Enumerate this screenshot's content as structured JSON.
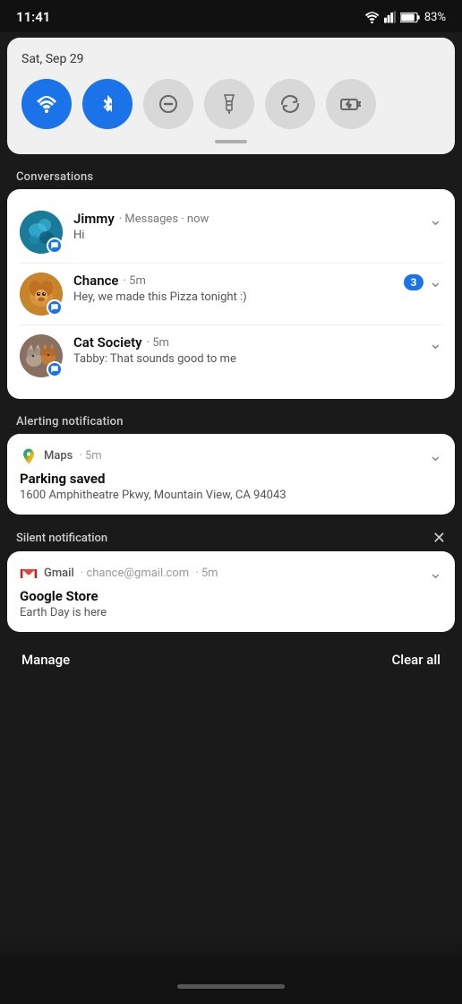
{
  "statusBar": {
    "time": "11:41",
    "battery": "83%"
  },
  "quickSettings": {
    "date": "Sat, Sep 29",
    "buttons": [
      {
        "id": "wifi",
        "label": "WiFi",
        "active": true
      },
      {
        "id": "bluetooth",
        "label": "Bluetooth",
        "active": true
      },
      {
        "id": "dnd",
        "label": "Do Not Disturb",
        "active": false
      },
      {
        "id": "flashlight",
        "label": "Flashlight",
        "active": false
      },
      {
        "id": "rotate",
        "label": "Auto Rotate",
        "active": false
      },
      {
        "id": "battery",
        "label": "Battery Saver",
        "active": false
      }
    ]
  },
  "sections": {
    "conversations": "Conversations",
    "alerting": "Alerting notification",
    "silent": "Silent notification"
  },
  "conversations": [
    {
      "name": "Jimmy",
      "app": "Messages",
      "time": "now",
      "message": "Hi",
      "badge": null
    },
    {
      "name": "Chance",
      "app": "",
      "time": "5m",
      "message": "Hey, we made this Pizza tonight :)",
      "badge": "3"
    },
    {
      "name": "Cat Society",
      "app": "",
      "time": "5m",
      "message": "Tabby: That sounds good to me",
      "badge": null
    }
  ],
  "alertingNotification": {
    "app": "Maps",
    "time": "5m",
    "title": "Parking saved",
    "body": "1600 Amphitheatre Pkwy, Mountain View, CA 94043"
  },
  "silentNotification": {
    "app": "Gmail",
    "email": "chance@gmail.com",
    "time": "5m",
    "title": "Google Store",
    "body": "Earth Day is here"
  },
  "bottomBar": {
    "manage": "Manage",
    "clearAll": "Clear all"
  }
}
